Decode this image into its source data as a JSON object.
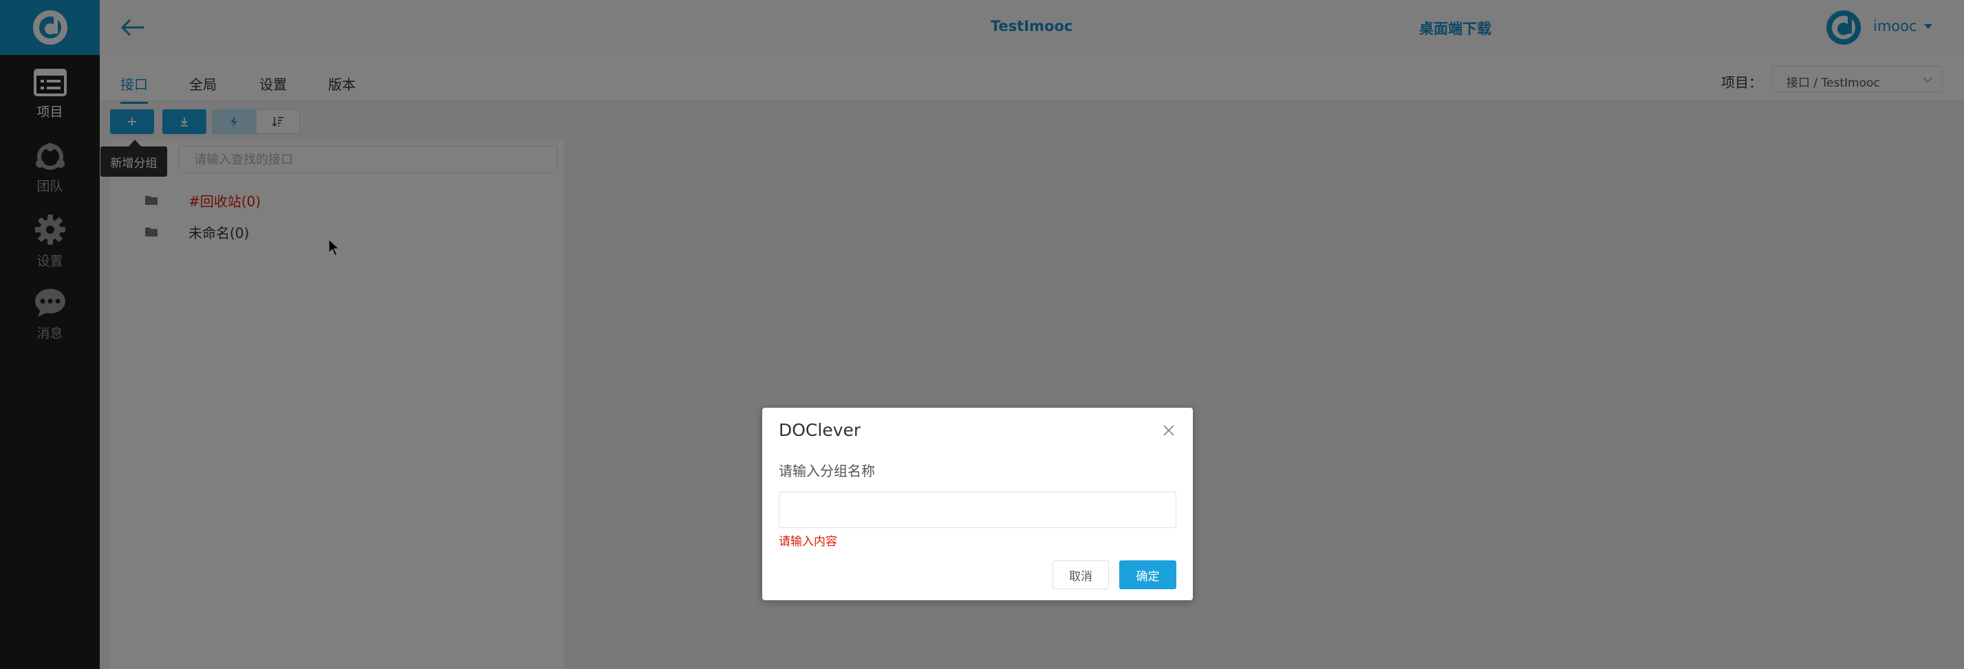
{
  "sidebar": {
    "logo": "doclever-logo-icon",
    "items": [
      {
        "label": "项目",
        "icon": "project-icon",
        "active": true
      },
      {
        "label": "团队",
        "icon": "team-icon",
        "active": false
      },
      {
        "label": "设置",
        "icon": "gear-icon",
        "active": false
      },
      {
        "label": "消息",
        "icon": "message-icon",
        "active": false
      }
    ]
  },
  "header": {
    "title": "TestImooc",
    "download": "桌面端下载",
    "username": "imooc"
  },
  "tabs": [
    {
      "label": "接口",
      "active": true
    },
    {
      "label": "全局",
      "active": false
    },
    {
      "label": "设置",
      "active": false
    },
    {
      "label": "版本",
      "active": false
    }
  ],
  "project": {
    "label": "项目：",
    "selected": "接口 / TestImooc"
  },
  "toolbar": {
    "tooltip": "新增分组",
    "buttons": [
      "plus-icon",
      "import-icon",
      "flash-icon",
      "sort-icon"
    ]
  },
  "search": {
    "placeholder": "请输入查找的接口"
  },
  "tree": [
    {
      "label": "#回收站(0)",
      "icon": "folder-icon"
    },
    {
      "label": "未命名(0)",
      "icon": "folder-icon"
    }
  ],
  "dialog": {
    "title": "DOClever",
    "message": "请输入分组名称",
    "input_value": "",
    "error": "请输入内容",
    "cancel": "取消",
    "confirm": "确定"
  },
  "colors": {
    "brand": "#1b8fc6",
    "rail": "#1f1f1f",
    "error": "#d81e06",
    "primary_button": "#1ba2dc"
  }
}
